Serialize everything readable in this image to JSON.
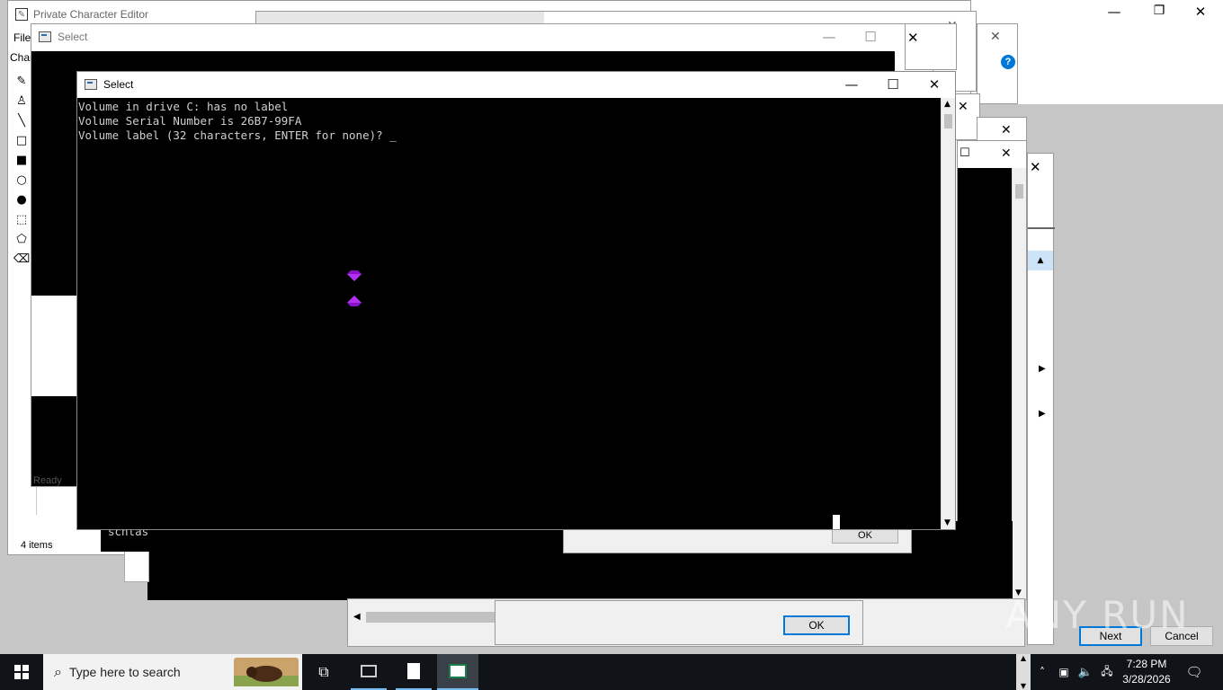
{
  "pce": {
    "title": "Private Character Editor",
    "menu_file": "File",
    "tab_char": "Char",
    "status": "Ready",
    "items": "4 items"
  },
  "explorer_bg": {
    "status": "4 items"
  },
  "select_back": {
    "title": "Select"
  },
  "select_front": {
    "title": "Select",
    "lines": [
      "Volume in drive C: has no label",
      "Volume Serial Number is 26B7-99FA",
      "Volume label (32 characters, ENTER for none)?"
    ],
    "cursor": "_"
  },
  "console_mid": {
    "text": "schtas"
  },
  "dialogs": {
    "ok_mid": "OK",
    "ok_bottom": "OK",
    "next": "Next",
    "cancel": "Cancel"
  },
  "icons": {
    "help": "?",
    "minimize": "—",
    "maximize": "☐",
    "close": "✕",
    "restore": "❐"
  },
  "watermark": "ANY RUN",
  "taskbar": {
    "search_placeholder": "Type here to search",
    "time": "7:28 PM",
    "date": "3/28/2026"
  },
  "colors": {
    "accent": "#0078d7",
    "console_bg": "#000000",
    "taskbar_bg": "#101418",
    "gem": "#8a12c9"
  }
}
